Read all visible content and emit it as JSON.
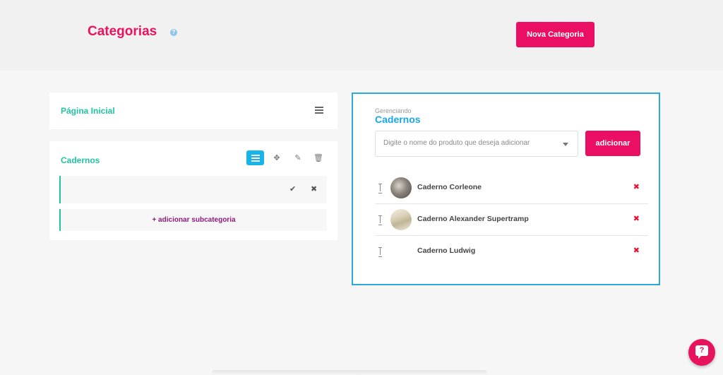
{
  "header": {
    "title": "Categorias",
    "help_glyph": "?",
    "new_category_label": "Nova Categoria"
  },
  "categories": [
    {
      "label": "Página Inicial"
    },
    {
      "label": "Cadernos"
    }
  ],
  "subcategory": {
    "add_label": "+ adicionar subcategoria",
    "confirm_glyph": "✔",
    "cancel_glyph": "✖"
  },
  "tools": {
    "move_glyph": "✥",
    "edit_glyph": "✎",
    "delete_glyph": "🗑"
  },
  "manage": {
    "label": "Gerenciando",
    "title": "Cadernos",
    "search_placeholder": "Digite o nome do produto que deseja adicionar",
    "add_label": "adicionar",
    "remove_glyph": "✖",
    "products": [
      {
        "name": "Caderno Corleone"
      },
      {
        "name": "Caderno Alexander Supertramp"
      },
      {
        "name": "Caderno Ludwig"
      }
    ]
  },
  "chat": {
    "glyph": "?"
  },
  "colors": {
    "accent": "#e8135f",
    "category_green": "#21c4a0",
    "manage_blue": "#17a8e3"
  }
}
